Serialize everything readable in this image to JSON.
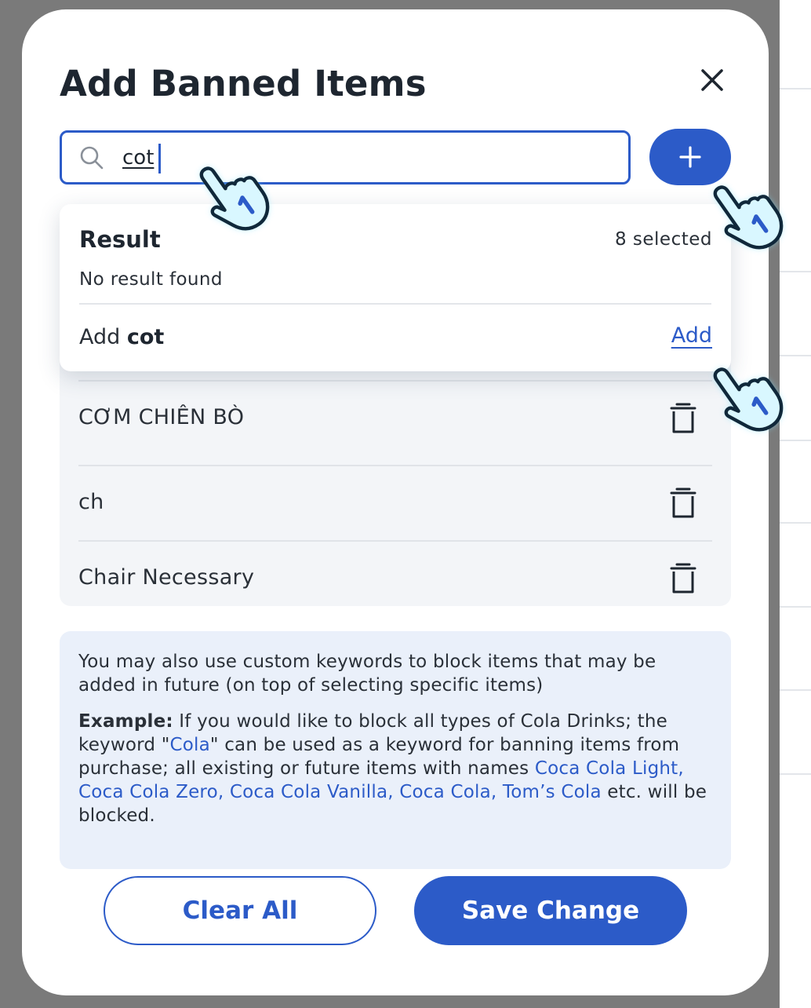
{
  "modal": {
    "title": "Add Banned Items"
  },
  "search": {
    "value": "cot"
  },
  "dropdown": {
    "title": "Result",
    "selected_count": "8 selected",
    "empty_text": "No result found",
    "add_prefix": "Add",
    "add_term": "cot",
    "add_link": "Add"
  },
  "items": [
    {
      "label": "CƠM CHIÊN BÒ"
    },
    {
      "label": "ch"
    },
    {
      "label": "Chair Necessary"
    }
  ],
  "info": {
    "line1": "You may also use custom keywords to block items that may be added in future (on top of selecting specific items)",
    "example_label": "Example:",
    "ex_part1": " If you would like to block all types of Cola Drinks; the keyword \"",
    "ex_keyword": "Cola",
    "ex_part2": "\" can be used as a keyword for banning items from purchase; all existing or future items with names ",
    "ex_names": "Coca Cola Light, Coca Cola Zero, Coca Cola Vanilla, Coca Cola, Tom’s Cola",
    "ex_part3": " etc. will be blocked."
  },
  "buttons": {
    "clear_all": "Clear All",
    "save_change": "Save Change"
  },
  "colors": {
    "primary": "#2c5bc8",
    "text": "#1e2630",
    "info_bg": "#eaf0fa",
    "list_bg": "#f3f5f8"
  },
  "icons": [
    "close-icon",
    "search-icon",
    "plus-icon",
    "trash-icon",
    "pointing-hand-icon"
  ]
}
